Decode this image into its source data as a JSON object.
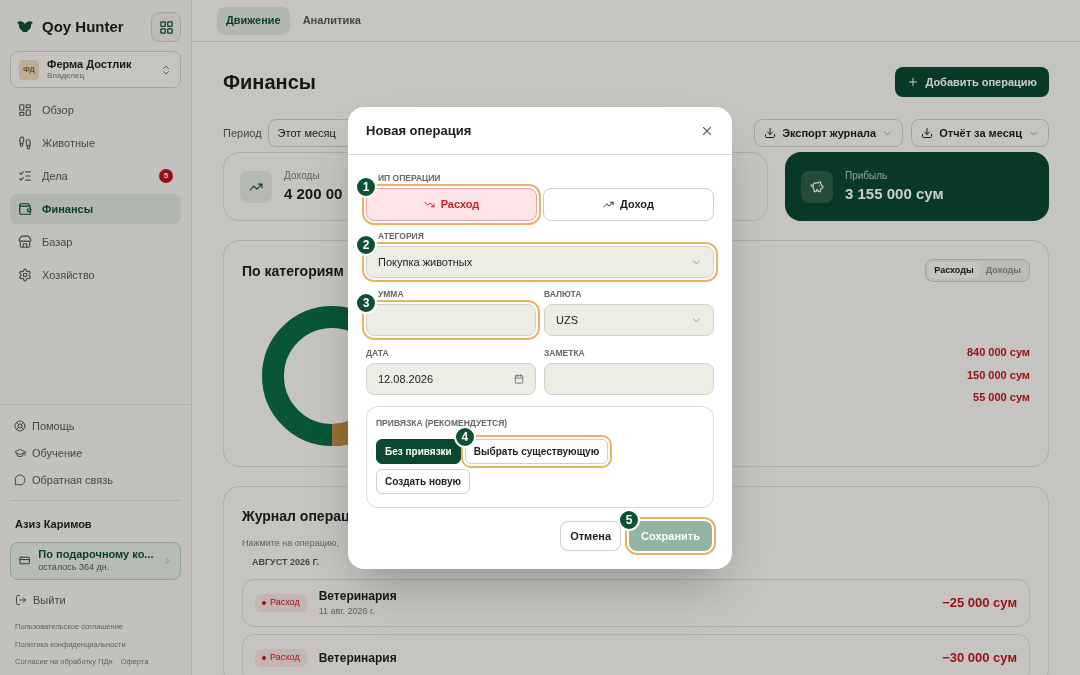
{
  "app": {
    "name": "Qoy Hunter"
  },
  "farm": {
    "initials": "ФД",
    "name": "Ферма Достлик",
    "role": "Владелец"
  },
  "nav": [
    {
      "label": "Обзор",
      "selected": false
    },
    {
      "label": "Животные",
      "selected": false
    },
    {
      "label": "Дела",
      "selected": false,
      "badge": "5"
    },
    {
      "label": "Финансы",
      "selected": true
    },
    {
      "label": "Базар",
      "selected": false
    },
    {
      "label": "Хозяйство",
      "selected": false
    }
  ],
  "help_links": [
    "Помощь",
    "Обучение",
    "Обратная связь"
  ],
  "user": {
    "name": "Азиз Каримов"
  },
  "plan": {
    "title": "По подарочному ко...",
    "subtitle": "осталось 364 дн."
  },
  "logout": "Выйти",
  "legal": [
    "Пользовательское соглашение",
    "Политика конфиденциальности",
    "Согласие на обработку ПДн",
    "Оферта"
  ],
  "tabs": [
    {
      "label": "Движение",
      "selected": true
    },
    {
      "label": "Аналитика",
      "selected": false
    }
  ],
  "page": {
    "title": "Финансы",
    "add_button": "Добавить операцию",
    "period_label": "Период",
    "period_value": "Этот месяц",
    "exports": [
      "Экспорт журнала",
      "Отчёт за месяц"
    ]
  },
  "summary": [
    {
      "kind": "income",
      "label": "Доходы",
      "value": "4 200 00"
    },
    {
      "kind": "hidden"
    },
    {
      "kind": "profit",
      "label": "Прибыль",
      "value": "3 155 000 сум"
    }
  ],
  "categories": {
    "title": "По категориям",
    "toggle": [
      {
        "label": "Расходы",
        "selected": true
      },
      {
        "label": "Доходы",
        "selected": false
      }
    ],
    "amounts": [
      "840 000 сум",
      "150 000 сум",
      "55 000 сум"
    ]
  },
  "journal": {
    "title": "Журнал операц",
    "hint": "Нажмите на операцию,",
    "month": "АВГУСТ 2026 Г.",
    "rows": [
      {
        "type": "Расход",
        "name": "Ветеринария",
        "date": "11 авг. 2026 г.",
        "amount": "−25 000 сум"
      },
      {
        "type": "Расход",
        "name": "Ветеринария",
        "amount": "−30 000 сум"
      }
    ]
  },
  "modal": {
    "title": "Новая операция",
    "type_label": "ИП ОПЕРАЦИИ",
    "types": [
      {
        "kind": "expense",
        "label": "Расход",
        "selected": true,
        "step": "1"
      },
      {
        "kind": "income",
        "label": "Доход",
        "selected": false
      }
    ],
    "category": {
      "label": "АТЕГОРИЯ",
      "value": "Покупка животных",
      "step": "2"
    },
    "amount": {
      "label": "УММА",
      "step": "3"
    },
    "currency": {
      "label": "ВАЛЮТА",
      "value": "UZS"
    },
    "date": {
      "label": "ДАТА",
      "value": "12.08.2026"
    },
    "note": {
      "label": "ЗАМЕТКА"
    },
    "link_label": "ПРИВЯЗКА (РЕКОМЕНДУЕТСЯ)",
    "link_options": [
      {
        "label": "Без привязки",
        "selected": true
      },
      {
        "label": "Выбрать существующую",
        "selected": false,
        "step": "4"
      },
      {
        "label": "Создать новую",
        "selected": false
      }
    ],
    "cancel": "Отмена",
    "save": {
      "label": "Сохранить",
      "disabled": true,
      "step": "5"
    }
  }
}
